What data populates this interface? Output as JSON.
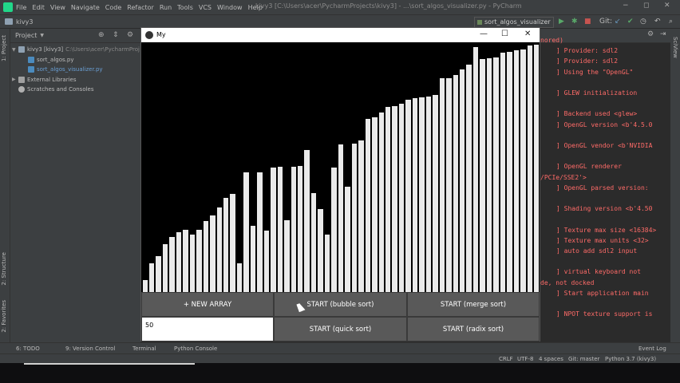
{
  "menubar": {
    "items": [
      "File",
      "Edit",
      "View",
      "Navigate",
      "Code",
      "Refactor",
      "Run",
      "Tools",
      "VCS",
      "Window",
      "Help"
    ],
    "window_title": "kivy3 [C:\\Users\\acer\\PycharmProjects\\kivy3] - ...\\sort_algos_visualizer.py - PyCharm",
    "min": "−",
    "max": "◻",
    "close": "✕"
  },
  "navbar": {
    "project": "kivy3",
    "run_config": "sort_algos_visualizer",
    "git_label": "Git:"
  },
  "left_tabs": {
    "project": "1: Project",
    "structure": "2: Structure",
    "favorites": "2: Favorites"
  },
  "project_panel": {
    "title": "Project",
    "tree": [
      {
        "label": "kivy3 [kivy3]",
        "path": "C:\\Users\\acer\\PycharmProj",
        "depth": 0,
        "type": "folder"
      },
      {
        "label": "sort_algos.py",
        "depth": 1,
        "type": "py"
      },
      {
        "label": "sort_algos_visualizer.py",
        "depth": 1,
        "type": "py",
        "highlight": true
      },
      {
        "label": "External Libraries",
        "depth": 0,
        "type": "lib"
      },
      {
        "label": "Scratches and Consoles",
        "depth": 0,
        "type": "scratch"
      }
    ]
  },
  "console": {
    "lines": [
      "nored)",
      "] Provider: sdl2",
      "] Provider: sdl2",
      "] Using the \"OpenGL\"",
      "",
      "] GLEW initialization",
      "",
      "] Backend used <glew>",
      "] OpenGL version <b'4.5.0",
      "",
      "] OpenGL vendor <b'NVIDIA",
      "",
      "] OpenGL renderer",
      "/PCIe/SSE2'>",
      "] OpenGL parsed version:",
      "",
      "] Shading version <b'4.50",
      "",
      "] Texture max size <16384>",
      "] Texture max units <32>",
      "] auto add sdl2 input",
      "",
      "] virtual keyboard not",
      "de, not docked",
      "] Start application main",
      "",
      "] NPOT texture support is"
    ]
  },
  "kivy_window": {
    "title": "My",
    "min": "—",
    "max": "☐",
    "close": "✕",
    "bars": [
      15,
      36,
      45,
      60,
      69,
      75,
      78,
      72,
      78,
      89,
      96,
      106,
      118,
      123,
      36,
      150,
      83,
      150,
      77,
      156,
      157,
      90,
      157,
      158,
      178,
      124,
      104,
      72,
      156,
      185,
      132,
      186,
      190,
      217,
      219,
      225,
      232,
      233,
      236,
      241,
      243,
      244,
      245,
      247,
      268,
      268,
      272,
      279,
      285,
      307,
      292,
      293,
      294,
      300,
      301,
      303,
      304,
      309,
      310
    ],
    "max_value": 313,
    "buttons": {
      "new_array": "+ NEW ARRAY",
      "bubble": "START (bubble sort)",
      "merge": "START (merge sort)",
      "quick": "START (quick sort)",
      "radix": "START (radix sort)"
    },
    "input_value": "50"
  },
  "bottom_tabs": [
    "6: TODO",
    "9: Version Control",
    "Terminal",
    "Python Console"
  ],
  "event_log": "Event Log",
  "status": {
    "crlf": "CRLF",
    "encoding": "UTF-8",
    "indent": "4 spaces",
    "git": "Git: master",
    "python": "Python 3.7 (kivy3)"
  }
}
